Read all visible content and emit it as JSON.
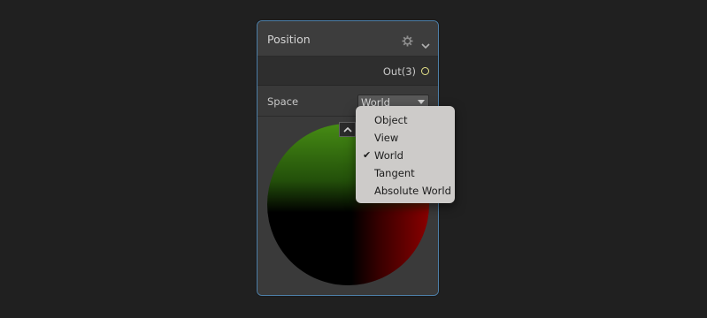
{
  "node": {
    "title": "Position",
    "icons": [
      "gear-icon",
      "chevron-down-icon"
    ],
    "output_port": {
      "label": "Out(3)",
      "color": "#e8e58a"
    },
    "space": {
      "label": "Space",
      "selected": "World"
    },
    "preview": {
      "collapse_icon": "chevron-up-icon"
    }
  },
  "dropdown": {
    "items": [
      {
        "label": "Object",
        "checked": false
      },
      {
        "label": "View",
        "checked": false
      },
      {
        "label": "World",
        "checked": true
      },
      {
        "label": "Tangent",
        "checked": false
      },
      {
        "label": "Absolute World",
        "checked": false
      }
    ],
    "check_glyph": "✔"
  },
  "colors": {
    "background": "#202020",
    "node_border": "#4d7fa8",
    "menu_background": "#cdcbc9"
  }
}
